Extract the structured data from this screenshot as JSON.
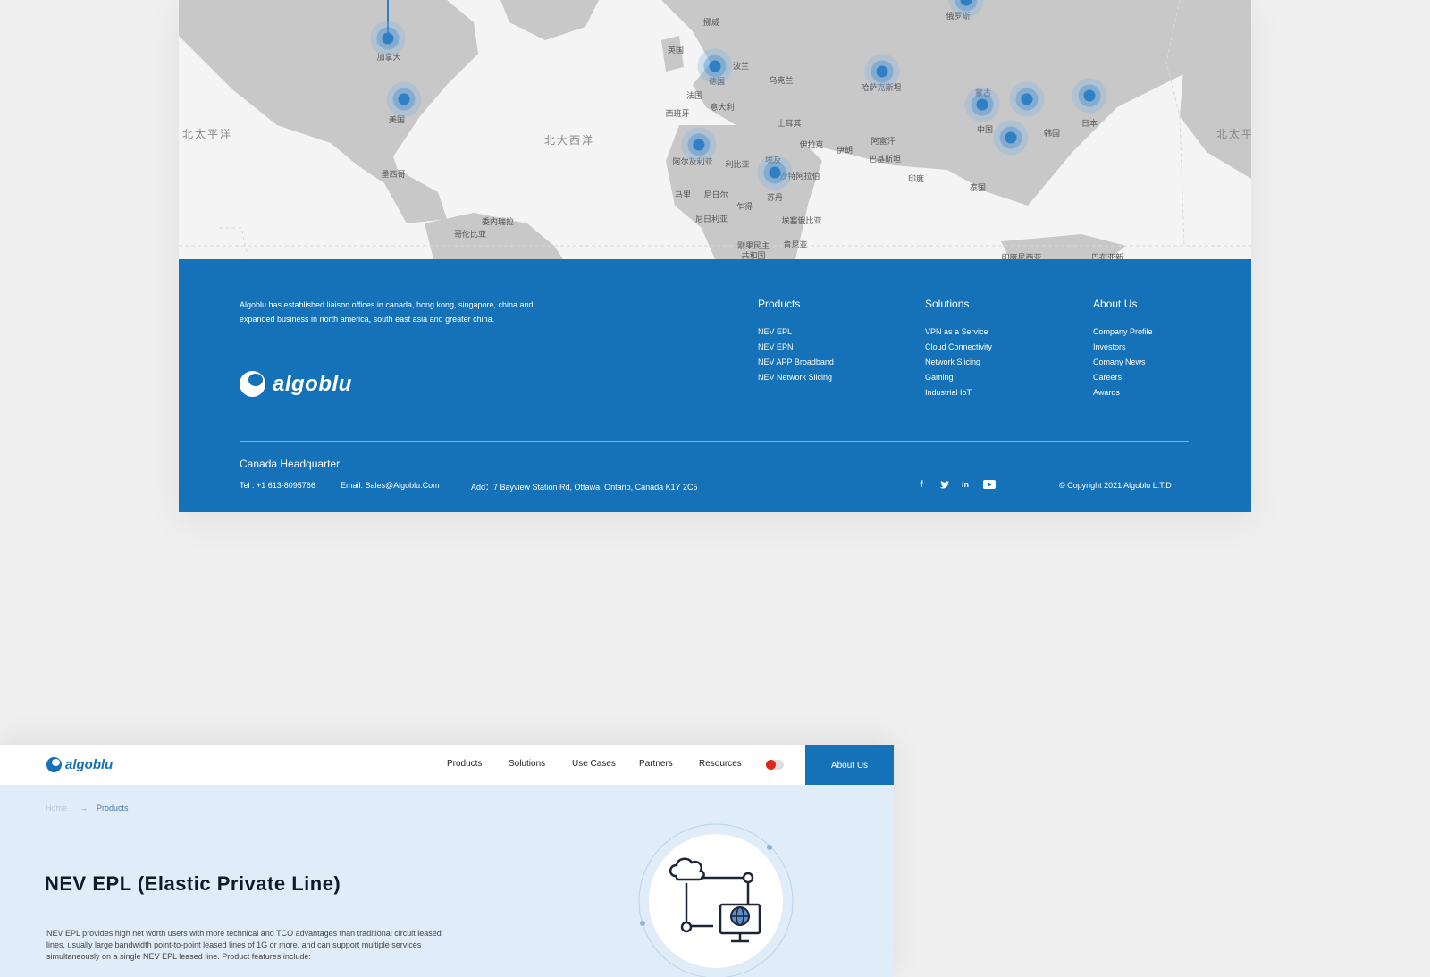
{
  "map": {
    "countries": [
      "加拿大",
      "美国",
      "墨西哥",
      "委内瑞拉",
      "哥伦比亚",
      "挪威",
      "俄罗斯",
      "英国",
      "德国",
      "波兰",
      "乌克兰",
      "法国",
      "西班牙",
      "意大利",
      "土耳其",
      "哈萨克斯坦",
      "蒙古",
      "中国",
      "韩国",
      "日本",
      "阿尔及利亚",
      "利比亚",
      "埃及",
      "伊拉克",
      "伊朗",
      "阿富汗",
      "巴基斯坦",
      "沙特阿拉伯",
      "印度",
      "泰国",
      "马里",
      "尼日尔",
      "乍得",
      "苏丹",
      "尼日利亚",
      "埃塞俄比亚",
      "刚果民主",
      "共和国",
      "肯尼亚",
      "印度尼西亚",
      "巴布亚新"
    ],
    "oceans": [
      "北太平洋",
      "北大西洋",
      "北太平"
    ]
  },
  "footer": {
    "about_text": "Algoblu has established liaison offices in canada, hong kong, singapore, china and expanded business in north america, south east asia and greater china.",
    "logo_text": "algoblu",
    "columns": [
      {
        "title": "Products",
        "links": [
          "NEV EPL",
          "NEV EPN",
          "NEV APP Broadband",
          "NEV Network Slicing"
        ]
      },
      {
        "title": "Solutions",
        "links": [
          "VPN as a Service",
          "Cloud Connectivity",
          "Network Slicing",
          "Gaming",
          "Industrial IoT"
        ]
      },
      {
        "title": "About Us",
        "links": [
          "Company Profile",
          "Investors",
          "Comany News",
          "Careers",
          "Awards"
        ]
      }
    ],
    "hq_title": "Canada Headquarter",
    "tel": "Tel : +1 613-8095766",
    "email": "Email: Sales@Algoblu.Com",
    "address": "Add：7 Bayview Station Rd, Ottawa, Ontario, Canada K1Y 2C5",
    "social": [
      "facebook-icon",
      "twitter-icon",
      "linkedin-icon",
      "youtube-icon"
    ],
    "copyright": "© Copyright 2021 Algoblu L.T.D"
  },
  "nav": {
    "logo_text": "algoblu",
    "items": [
      "Products",
      "Solutions",
      "Use Cases",
      "Partners",
      "Resources"
    ],
    "about_btn": "About Us"
  },
  "breadcrumb": {
    "home": "Home",
    "current": "Products"
  },
  "hero": {
    "title": "NEV EPL (Elastic Private Line)",
    "description": "NEV EPL provides high net worth users with more technical and TCO advantages than traditional circuit leased lines, usually large bandwidth point-to-point leased lines of 1G or more, and can support multiple services simultaneously on a single NEV EPL leased line. Product features include:"
  },
  "colors": {
    "brand": "#1571b8",
    "map_land": "#c8c8c8",
    "page_bg": "#efefef",
    "hero_bg": "#e0ecf7"
  }
}
